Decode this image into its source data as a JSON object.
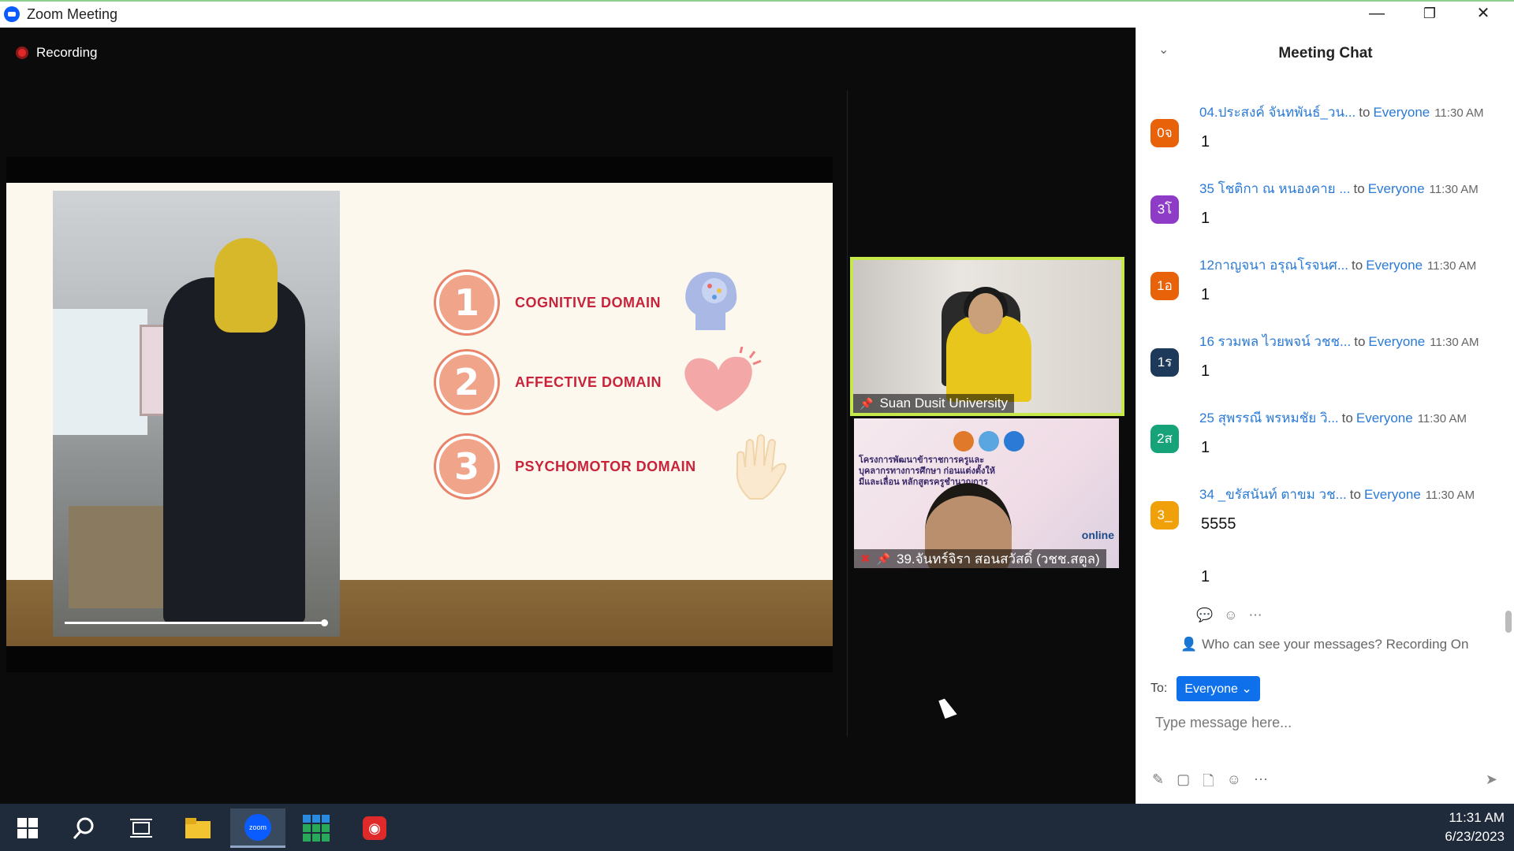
{
  "window": {
    "title": "Zoom Meeting",
    "minimize": "—",
    "restore": "❐",
    "close": "✕"
  },
  "recording": "Recording",
  "slide": {
    "domains": [
      {
        "num": "1",
        "label": "COGNITIVE DOMAIN"
      },
      {
        "num": "2",
        "label": "AFFECTIVE DOMAIN"
      },
      {
        "num": "3",
        "label": "PSYCHOMOTOR DOMAIN"
      }
    ]
  },
  "participants": [
    {
      "name": "Suan Dusit University"
    },
    {
      "name": "39.จันทร์จิรา สอนสวัสดิ์ (วชช.สตูล)",
      "caption": "โครงการพัฒนาข้าราชการครูและบุคลากรทางการศึกษา ก่อนแต่งตั้งให้มีและเลื่อน หลักสูตรครูชำนาญการ",
      "badge": "online"
    }
  ],
  "chat": {
    "title": "Meeting Chat",
    "messages": [
      {
        "avatar": "0จ",
        "color": "#e8620a",
        "sender": "04.ประสงค์ จันทพันธ์_วน...",
        "to": "to",
        "recipient": "Everyone",
        "time": "11:30 AM",
        "text": "1"
      },
      {
        "avatar": "3โ",
        "color": "#8e3cc8",
        "sender": "35 โชติกา ณ หนองคาย ...",
        "to": "to",
        "recipient": "Everyone",
        "time": "11:30 AM",
        "text": "1"
      },
      {
        "avatar": "1อ",
        "color": "#e8620a",
        "sender": "12กาญจนา อรุณโรจนศ...",
        "to": "to",
        "recipient": "Everyone",
        "time": "11:30 AM",
        "text": "1"
      },
      {
        "avatar": "1ร",
        "color": "#1e3a5a",
        "sender": "16 รวมพล ไวยพจน์ วชช...",
        "to": "to",
        "recipient": "Everyone",
        "time": "11:30 AM",
        "text": "1"
      },
      {
        "avatar": "2ส",
        "color": "#16a37a",
        "sender": "25 สุพรรณี พรหมชัย วิ...",
        "to": "to",
        "recipient": "Everyone",
        "time": "11:30 AM",
        "text": "1"
      },
      {
        "avatar": "3_",
        "color": "#f0a10a",
        "sender": "34 _ขรัสนันท์ ตาขม วช...",
        "to": "to",
        "recipient": "Everyone",
        "time": "11:30 AM",
        "text": "5555"
      }
    ],
    "extra_text": "1",
    "visibility": "Who can see your messages? Recording On",
    "to_label": "To:",
    "to_value": "Everyone",
    "placeholder": "Type message here..."
  },
  "taskbar": {
    "time": "11:31 AM",
    "date": "6/23/2023",
    "zoom_label": "zoom"
  }
}
